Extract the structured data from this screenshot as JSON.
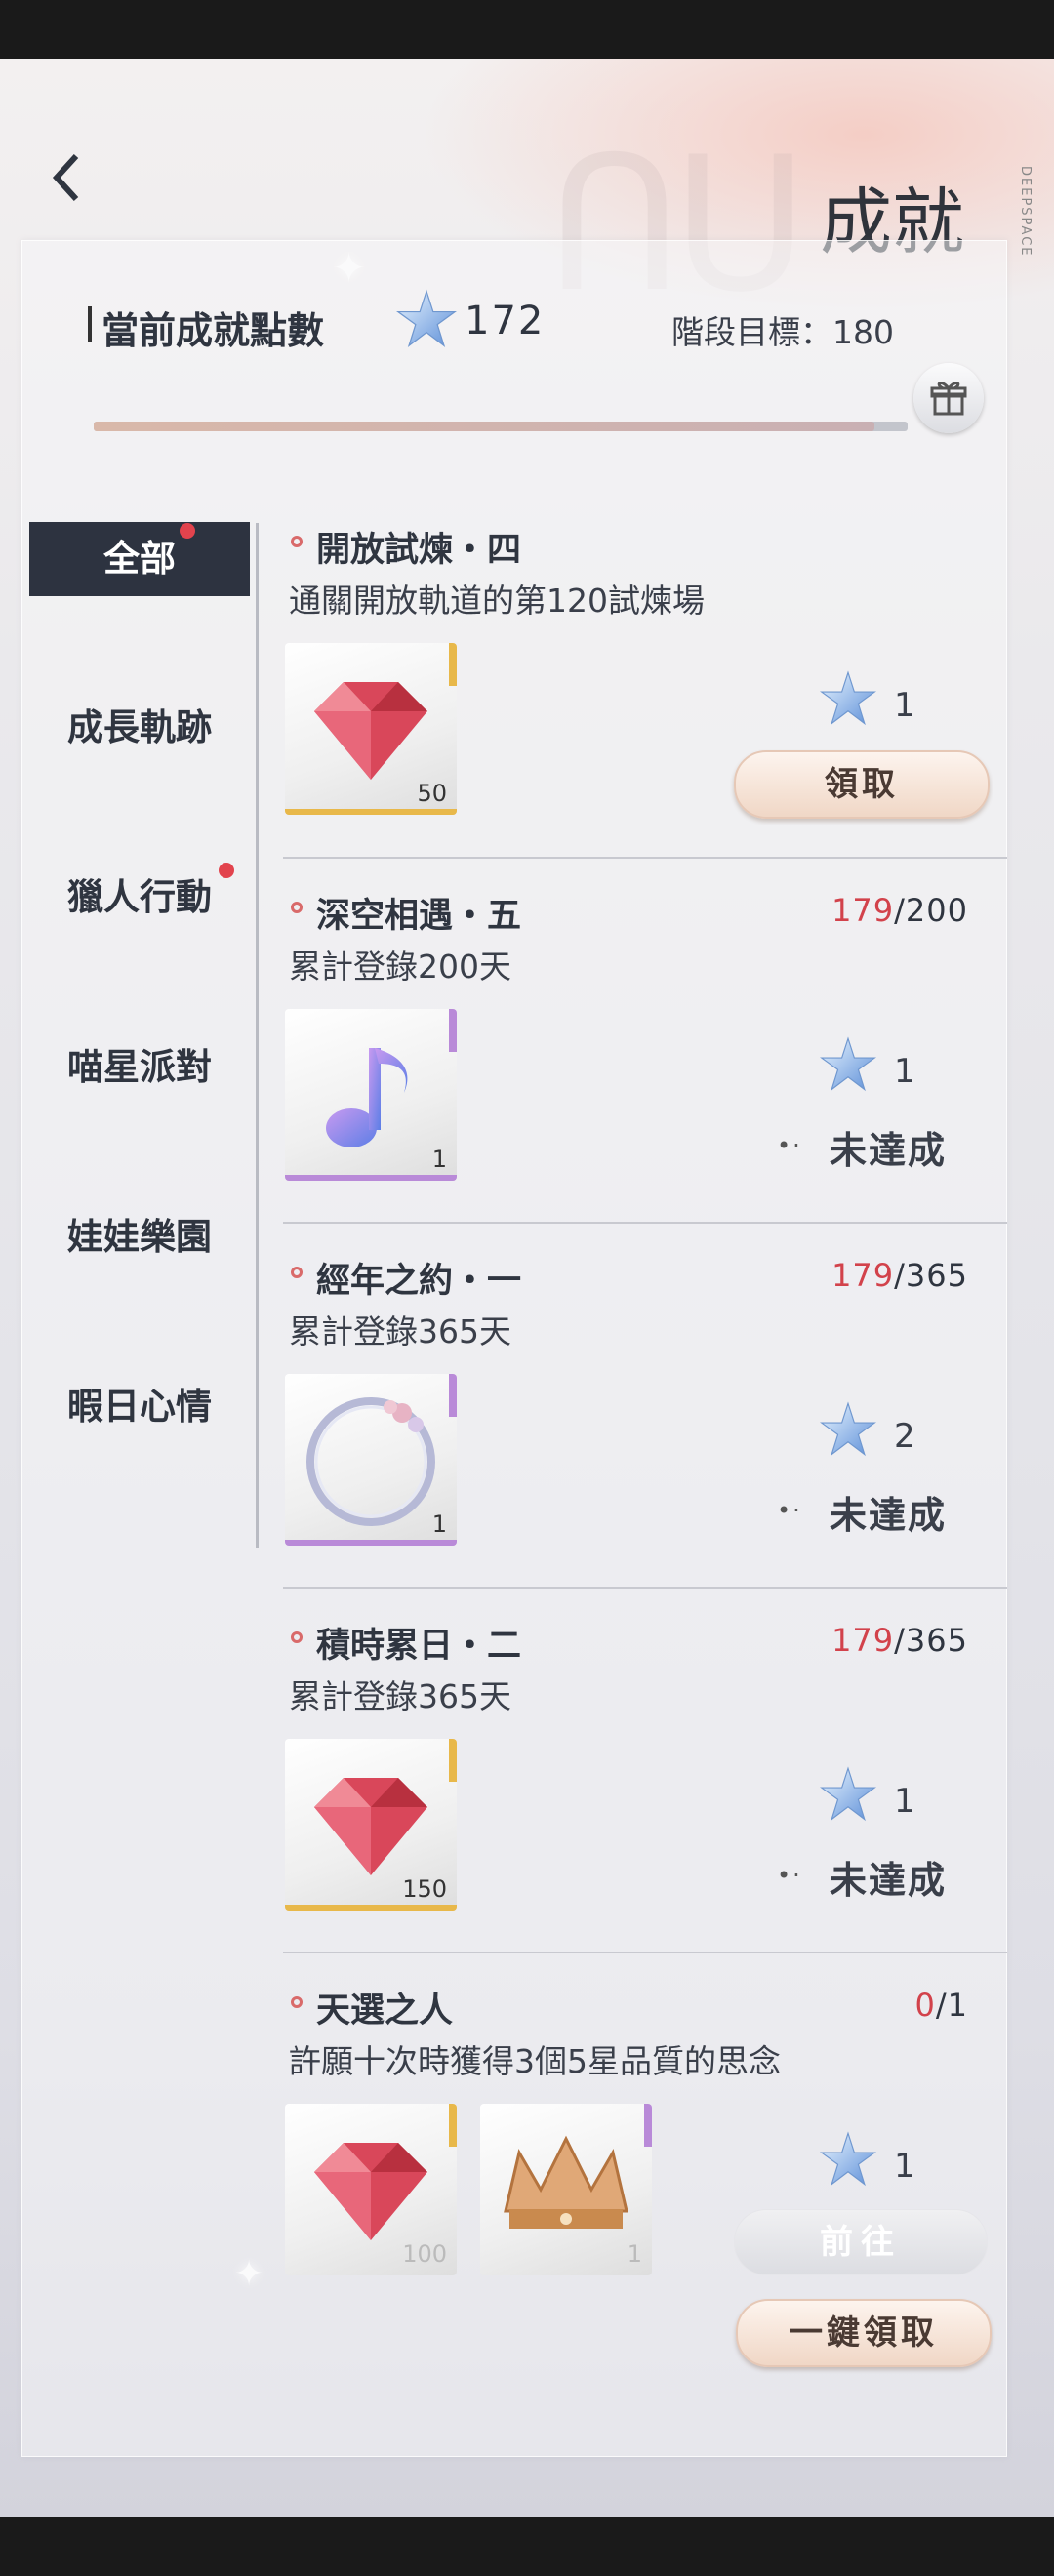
{
  "header": {
    "title": "成就",
    "brand": "DEEPSPACE",
    "back_icon": "back-chevron-icon"
  },
  "points": {
    "label": "當前成就點數",
    "value": "172",
    "stage_label": "階段目標：180",
    "progress": 0.956
  },
  "sidebar": {
    "items": [
      {
        "label": "全部",
        "active": true,
        "badge": true
      },
      {
        "label": "成長軌跡",
        "active": false,
        "badge": false
      },
      {
        "label": "獵人行動",
        "active": false,
        "badge": true
      },
      {
        "label": "喵星派對",
        "active": false,
        "badge": false
      },
      {
        "label": "娃娃樂園",
        "active": false,
        "badge": false
      },
      {
        "label": "暇日心情",
        "active": false,
        "badge": false
      }
    ]
  },
  "achievements": [
    {
      "title": "開放試煉・四",
      "desc": "通關開放軌道的第120試煉場",
      "progress_current": "",
      "progress_total": "",
      "rewards": [
        {
          "icon": "red-diamond-icon",
          "qty": "50",
          "color": "#e8b84a"
        }
      ],
      "points": "1",
      "status": "領取"
    },
    {
      "title": "深空相遇・五",
      "desc": "累計登錄200天",
      "progress_current": "179",
      "progress_total": "/200",
      "rewards": [
        {
          "icon": "music-note-icon",
          "qty": "1",
          "color": "#b98ad8"
        }
      ],
      "points": "1",
      "status": "未達成"
    },
    {
      "title": "經年之約・一",
      "desc": "累計登錄365天",
      "progress_current": "179",
      "progress_total": "/365",
      "rewards": [
        {
          "icon": "floral-ring-frame-icon",
          "qty": "1",
          "color": "#b98ad8"
        }
      ],
      "points": "2",
      "status": "未達成"
    },
    {
      "title": "積時累日・二",
      "desc": "累計登錄365天",
      "progress_current": "179",
      "progress_total": "/365",
      "rewards": [
        {
          "icon": "red-diamond-icon",
          "qty": "150",
          "color": "#e8b84a"
        }
      ],
      "points": "1",
      "status": "未達成"
    },
    {
      "title": "天選之人",
      "desc": "許願十次時獲得3個5星品質的思念",
      "progress_current": "0",
      "progress_total": "/1",
      "rewards": [
        {
          "icon": "red-diamond-icon",
          "qty": "100",
          "color": "#e8b84a"
        },
        {
          "icon": "gold-crown-icon",
          "qty": "1",
          "color": "#b98ad8"
        }
      ],
      "points": "1",
      "status": "前往"
    }
  ],
  "footer": {
    "claim_all": "一鍵領取"
  }
}
